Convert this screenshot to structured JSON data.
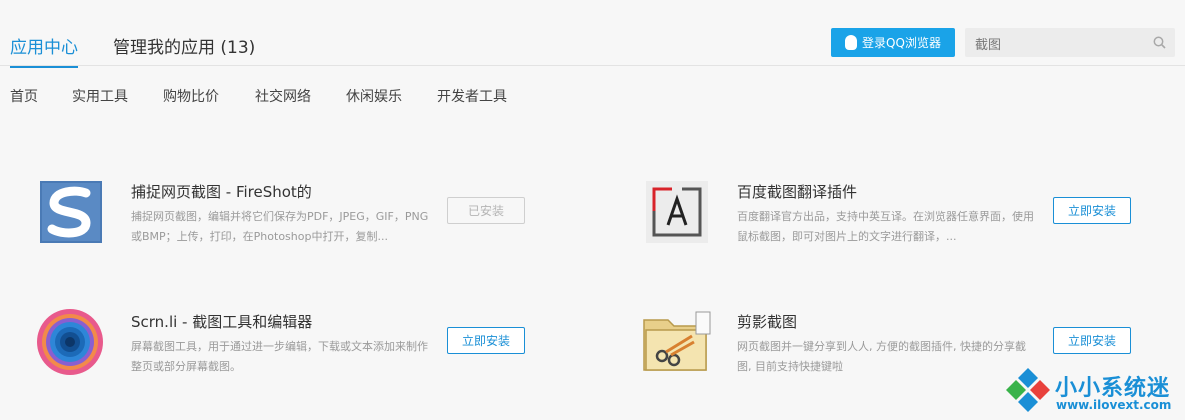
{
  "header": {
    "tab_active": "应用中心",
    "tab_manage": "管理我的应用 (13)",
    "qq_button": "登录QQ浏览器",
    "search_value": "截图"
  },
  "nav": [
    "首页",
    "实用工具",
    "购物比价",
    "社交网络",
    "休闲娱乐",
    "开发者工具"
  ],
  "apps": [
    {
      "title": "捕捉网页截图 - FireShot的",
      "desc": "捕捉网页截图，编辑并将它们保存为PDF，JPEG，GIF，PNG或BMP；上传，打印，在Photoshop中打开，复制...",
      "button": "已安装"
    },
    {
      "title": "百度截图翻译插件",
      "desc": "百度翻译官方出品，支持中英互译。在浏览器任意界面，使用鼠标截图，即可对图片上的文字进行翻译，...",
      "button": "立即安装"
    },
    {
      "title": "Scrn.li - 截图工具和编辑器",
      "desc": "屏幕截图工具，用于通过进一步编辑，下载或文本添加来制作整页或部分屏幕截图。",
      "button": "立即安装"
    },
    {
      "title": "剪影截图",
      "desc": "网页截图并一键分享到人人, 方便的截图插件, 快捷的分享截图, 目前支持快捷键啦",
      "button": "立即安装"
    }
  ],
  "watermark": {
    "line1": "小小系统迷",
    "line2": "www.ilovext.com"
  },
  "colors": {
    "accent": "#1a8fd6",
    "qq_button": "#1aa3e8"
  }
}
